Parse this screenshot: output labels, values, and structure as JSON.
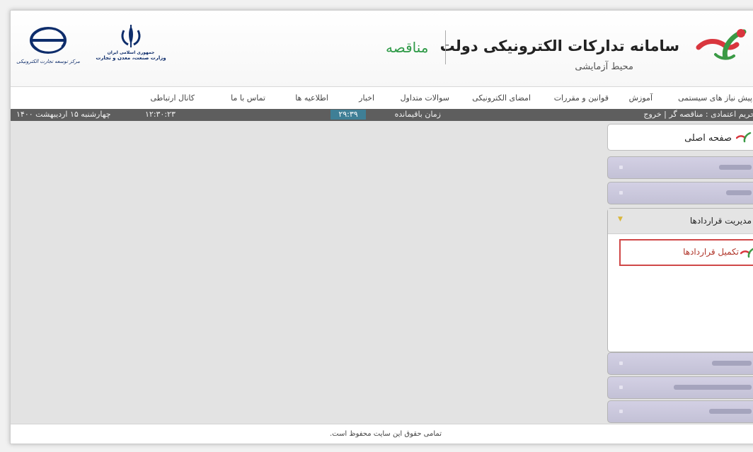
{
  "header": {
    "system_title": "سامانه تدارکات الکترونیکی دولت",
    "environment": "محیط آزمایشی",
    "section": "مناقصه",
    "ministry_line1": "جمهوری اسلامی ایران",
    "ministry_line2": "وزارت صنعت، معدن و تجارت",
    "center_name": "مرکز توسعه تجارت الکترونیکی"
  },
  "nav": {
    "items": [
      "پیش نیاز های سیستمی",
      "آموزش",
      "قوانین و مقررات",
      "امضای الکترونیکی",
      "سوالات متداول",
      "اخبار",
      "اطلاعیه ها",
      "تماس با ما",
      "کانال ارتباطی"
    ]
  },
  "status": {
    "user_info": "حریم اعتمادی : مناقصه گر | خروج",
    "time_remaining_label": "زمان باقیمانده",
    "time_remaining": "۲۹:۳۹",
    "clock": "۱۲:۳۰:۲۳",
    "date": "چهارشنبه ۱۵ اردیبهشت ۱۴۰۰"
  },
  "sidebar": {
    "home_label": "صفحه اصلی",
    "open_panel_label": "مدیریت قراردادها",
    "sub_item_label": "تکمیل قراردادها"
  },
  "footer": {
    "text": "تمامی حقوق این سایت محفوظ است."
  },
  "colors": {
    "accent_green": "#2e9a47",
    "logo_red": "#d9363e",
    "statusbar": "#5e5e5e",
    "timer": "#3f7f96",
    "highlight_border": "#d04747"
  }
}
